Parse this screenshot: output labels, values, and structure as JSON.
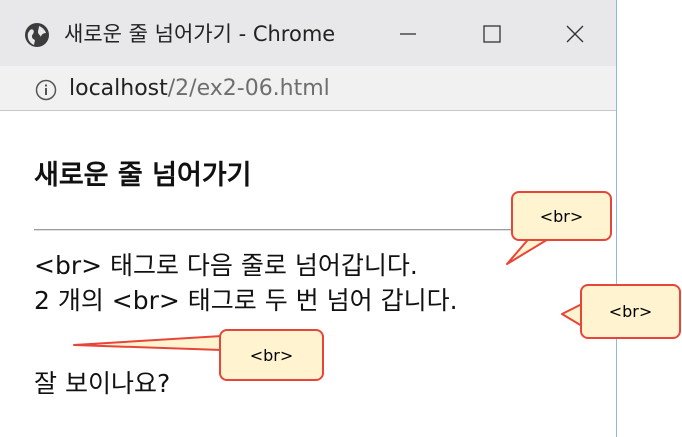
{
  "window": {
    "title": "새로운 줄 넘어가기 - Chrome",
    "controls": {
      "minimize": "—",
      "maximize": "☐",
      "close": "✕"
    }
  },
  "address_bar": {
    "host": "localhost",
    "path": "/2/ex2-06.html"
  },
  "page": {
    "heading": "새로운 줄 넘어가기",
    "lines": [
      "<br> 태그로 다음 줄로 넘어갑니다.",
      "2 개의 <br> 태그로 두 번 넘어 갑니다.",
      "잘 보이나요?"
    ]
  },
  "annotations": [
    {
      "text": "<br>"
    },
    {
      "text": "<br>"
    },
    {
      "text": "<br>"
    }
  ],
  "colors": {
    "callout_fill": "#fff4cf",
    "callout_border": "#e8453a",
    "titlebar": "#e8e8ea",
    "window_border": "#8fb8e8"
  }
}
